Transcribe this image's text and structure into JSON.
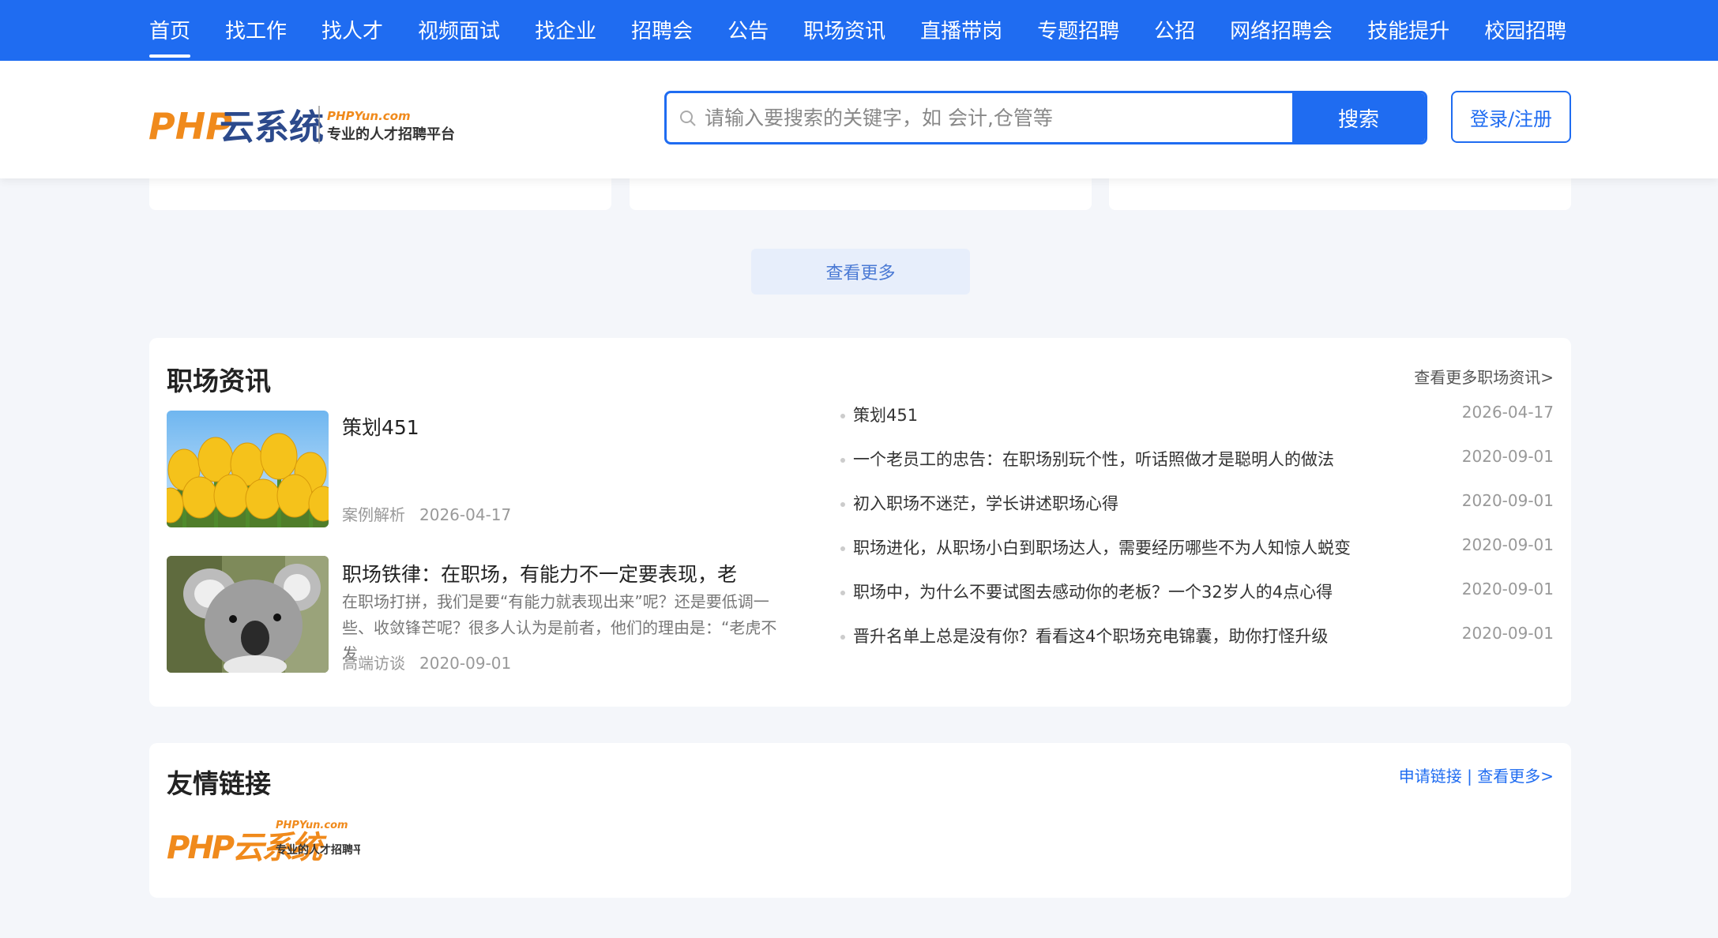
{
  "nav": {
    "items": [
      "首页",
      "找工作",
      "找人才",
      "视频面试",
      "找企业",
      "招聘会",
      "公告",
      "职场资讯",
      "直播带岗",
      "专题招聘",
      "公招",
      "网络招聘会",
      "技能提升",
      "校园招聘"
    ]
  },
  "header": {
    "logo_main": "PHP",
    "logo_cn": "云系统",
    "logo_en": "PHPYun.com",
    "logo_slogan": "专业的人才招聘平台",
    "search_placeholder": "请输入要搜索的关键字，如 会计,仓管等",
    "search_button": "搜索",
    "login_button": "登录/注册"
  },
  "view_more": "查看更多",
  "news": {
    "title": "职场资讯",
    "more": "查看更多职场资讯>",
    "featured": [
      {
        "title": "策划451",
        "summary": "",
        "category": "案例解析",
        "date": "2026-04-17",
        "image": "tulips-photo"
      },
      {
        "title": "职场铁律：在职场，有能力不一定要表现，老",
        "summary": "在职场打拼，我们是要“有能力就表现出来”呢？还是要低调一些、收敛锋芒呢？很多人认为是前者，他们的理由是：“老虎不发",
        "category": "高端访谈",
        "date": "2020-09-01",
        "image": "koala-photo"
      }
    ],
    "list": [
      {
        "title": "策划451",
        "date": "2026-04-17"
      },
      {
        "title": "一个老员工的忠告：在职场别玩个性，听话照做才是聪明人的做法",
        "date": "2020-09-01"
      },
      {
        "title": "初入职场不迷茫，学长讲述职场心得",
        "date": "2020-09-01"
      },
      {
        "title": "职场进化，从职场小白到职场达人，需要经历哪些不为人知惊人蜕变",
        "date": "2020-09-01"
      },
      {
        "title": "职场中，为什么不要试图去感动你的老板？一个32岁人的4点心得",
        "date": "2020-09-01"
      },
      {
        "title": "晋升名单上总是没有你？看看这4个职场充电锦囊，助你打怪升级",
        "date": "2020-09-01"
      }
    ]
  },
  "links": {
    "title": "友情链接",
    "apply": "申请链接",
    "separator": "|",
    "more": "查看更多>",
    "partner_logo_text": "PHP云系统",
    "partner_logo_en": "PHPYun.com",
    "partner_logo_slogan": "专业的人才招聘平台"
  },
  "colors": {
    "brand_blue": "#1f6cf1",
    "logo_orange": "#f08a1c",
    "logo_blue": "#2c4a8c"
  }
}
